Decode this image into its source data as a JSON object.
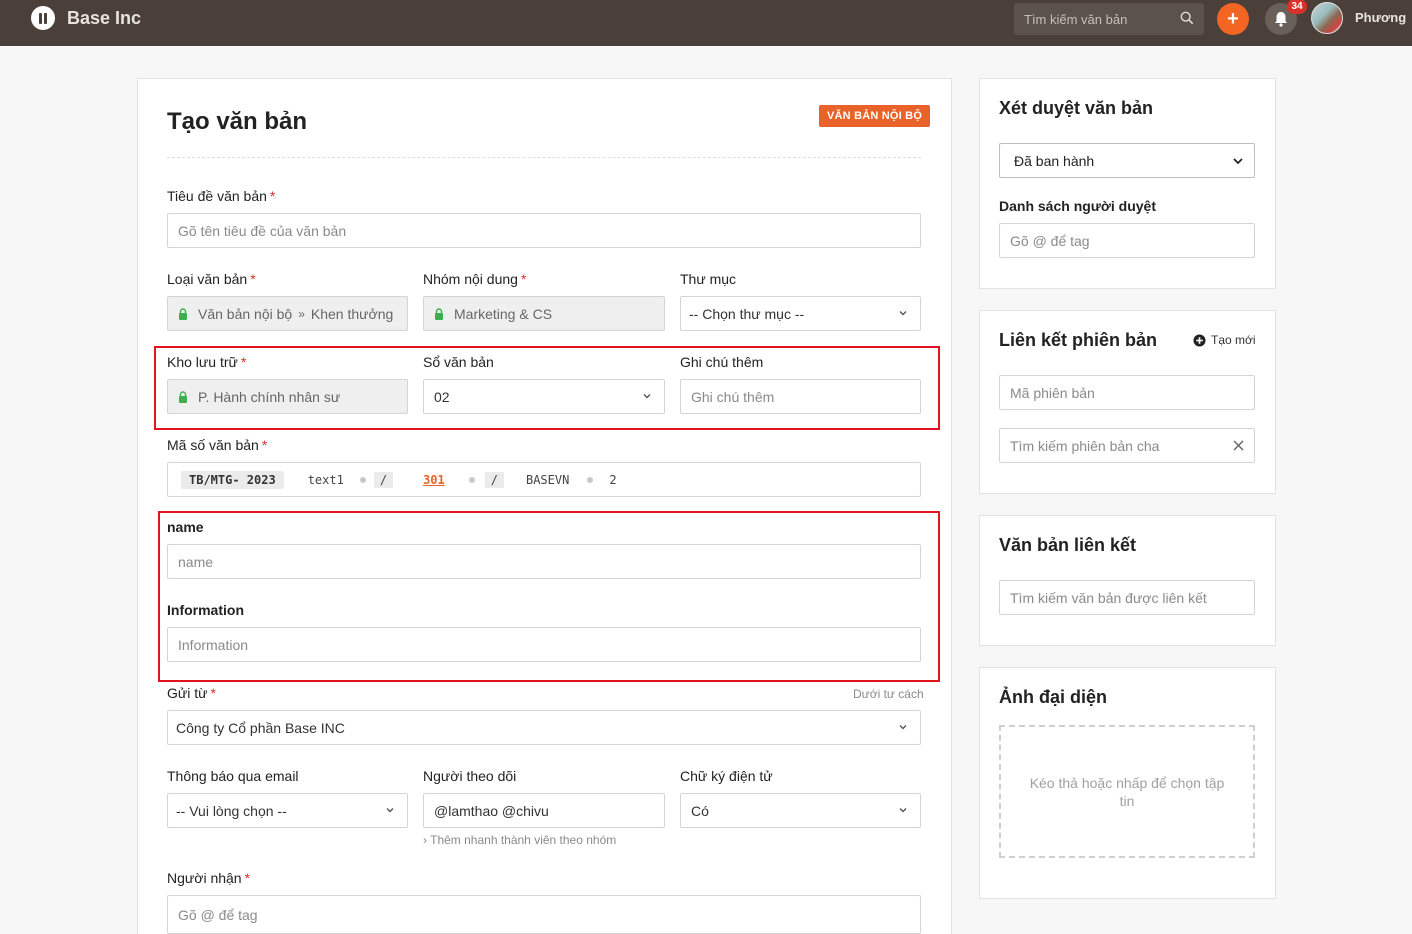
{
  "topbar": {
    "brand": "Base Inc",
    "search_placeholder": "Tìm kiếm văn bản",
    "plus_label": "+",
    "notification_count": "34",
    "username": "Phương"
  },
  "form": {
    "title": "Tạo văn bản",
    "type_badge": "VĂN BẢN NỘI BỘ",
    "doc_title": {
      "label": "Tiêu đề văn bản",
      "placeholder": "Gõ tên tiêu đề của văn bản"
    },
    "doc_type": {
      "label": "Loại văn bản",
      "value_a": "Văn bản nội bộ",
      "separator": "»",
      "value_b": "Khen thưởng"
    },
    "content_group": {
      "label": "Nhóm nội dung",
      "value": "Marketing & CS"
    },
    "folder": {
      "label": "Thư mục",
      "value": "-- Chọn thư mục --"
    },
    "storage": {
      "label": "Kho lưu trữ",
      "value": "P. Hành chính nhân sư"
    },
    "register": {
      "label": "Sổ văn bản",
      "value": "02"
    },
    "note": {
      "label": "Ghi chú thêm",
      "placeholder": "Ghi chú thêm"
    },
    "doc_code": {
      "label": "Mã số văn bản",
      "prefix": "TB/MTG- 2023",
      "part1": "text1",
      "slash": "/",
      "number": "301",
      "org": "BASEVN",
      "suffix": "2"
    },
    "name": {
      "label": "name",
      "placeholder": "name"
    },
    "information": {
      "label": "Information",
      "placeholder": "Information"
    },
    "sender": {
      "label": "Gửi từ",
      "hint": "Dưới tư cách",
      "value": "Công ty Cổ phần Base INC"
    },
    "email_notify": {
      "label": "Thông báo qua email",
      "value": "-- Vui lòng chọn --"
    },
    "followers": {
      "label": "Người theo dõi",
      "value": "@lamthao @chivu",
      "hint": "› Thêm nhanh thành viên theo nhóm"
    },
    "e_signature": {
      "label": "Chữ ký điện tử",
      "value": "Có"
    },
    "recipients": {
      "label": "Người nhận",
      "placeholder": "Gõ @ để tag"
    }
  },
  "sidebar": {
    "review": {
      "title": "Xét duyệt văn bản",
      "status": "Đã ban hành",
      "approvers_label": "Danh sách người duyệt",
      "approvers_placeholder": "Gõ @ để tag"
    },
    "version_link": {
      "title": "Liên kết phiên bản",
      "create_label": "Tạo mới",
      "version_code_placeholder": "Mã phiên bản",
      "parent_search_placeholder": "Tìm kiếm phiên bản cha"
    },
    "linked_docs": {
      "title": "Văn bản liên kết",
      "search_placeholder": "Tìm kiếm văn bản được liên kết"
    },
    "avatar": {
      "title": "Ảnh đại diện",
      "dropzone_text": "Kéo thả hoặc nhấp để chọn tập tin"
    }
  },
  "colors": {
    "topbar": "#4a3f39",
    "accent": "#f26522",
    "badge": "#e8622a",
    "required": "#d9302a",
    "highlight_box": "#e0141c"
  }
}
